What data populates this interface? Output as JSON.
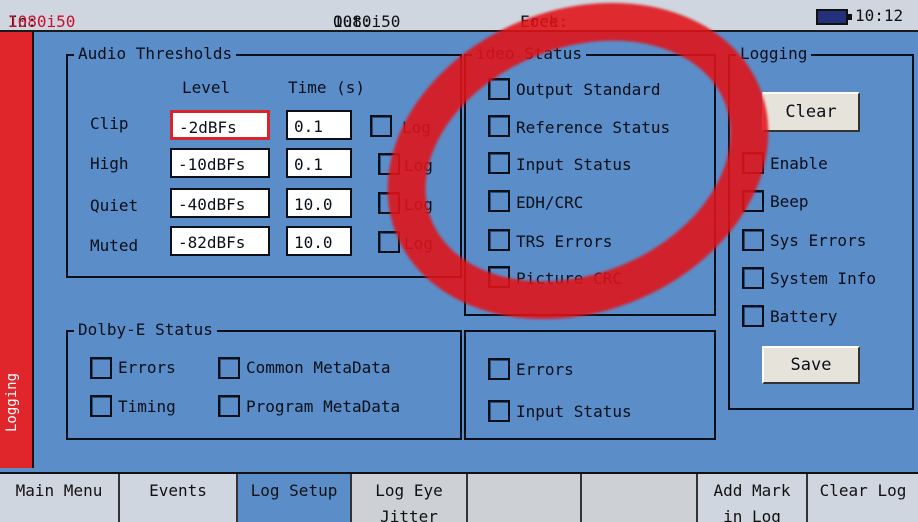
{
  "status_bar": {
    "in_label": "In:",
    "in_value": "1080i50",
    "out_label": "Out:",
    "out_value": "1080i50",
    "lock_label": "Lock:",
    "lock_value": "Free",
    "time": "10:12"
  },
  "side_tab": {
    "label": "Logging"
  },
  "audio_thresholds": {
    "title": "Audio Thresholds",
    "col_level": "Level",
    "col_time": "Time (s)",
    "rows": [
      {
        "label": "Clip",
        "level": "-2dBFs",
        "time": "0.1",
        "log": "Log"
      },
      {
        "label": "High",
        "level": "-10dBFs",
        "time": "0.1",
        "log": "Log"
      },
      {
        "label": "Quiet",
        "level": "-40dBFs",
        "time": "10.0",
        "log": "Log"
      },
      {
        "label": "Muted",
        "level": "-82dBFs",
        "time": "10.0",
        "log": "Log"
      }
    ]
  },
  "video_status": {
    "title": "ideo Status",
    "items": [
      "Output Standard",
      "Reference Status",
      "Input Status",
      "EDH/CRC",
      "TRS Errors",
      "Picture CRC"
    ]
  },
  "lower_middle": {
    "items": [
      "Errors",
      "Input Status"
    ]
  },
  "logging": {
    "title": "Logging",
    "clear_label": "Clear",
    "items": [
      "Enable",
      "Beep",
      "Sys Errors",
      "System Info",
      "Battery"
    ],
    "save_label": "Save"
  },
  "dolby": {
    "title": "Dolby-E Status",
    "items": [
      "Errors",
      "Common MetaData",
      "Timing",
      "Program MetaData"
    ]
  },
  "softkeys": [
    {
      "label": "Main Menu"
    },
    {
      "label": "Events"
    },
    {
      "label": "Log Setup"
    },
    {
      "label": "Log Eye",
      "label2": "Jitter"
    },
    {
      "label": ""
    },
    {
      "label": ""
    },
    {
      "label": "Add Mark",
      "label2": "in Log"
    },
    {
      "label": "Clear Log"
    }
  ],
  "colors": {
    "panel_blue": "#5b8dc8",
    "side_tab_red": "#e0262b",
    "focus_border": "#d6262b",
    "annotation_circle": "#e11218",
    "bar_gray": "#cfd6df"
  }
}
